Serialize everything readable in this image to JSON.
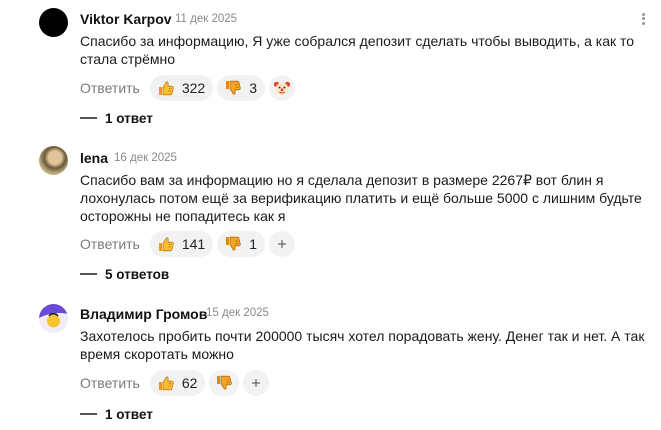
{
  "comments": [
    {
      "author": "Viktor Karpov",
      "date": "11 дек 2025",
      "text": "Спасибо за информацию, Я уже собрался депозит сделать чтобы выводить, а как то стала стрёмно",
      "reply_label": "Ответить",
      "likes": "322",
      "dislikes": "3",
      "extra_reaction": "clown-emoji-icon",
      "replies": "1 ответ"
    },
    {
      "author": "lena",
      "date": "16 дек 2025",
      "text": "Спасибо вам за информацию но я сделала депозит в размере 2267₽ вот блин я лохонулась потом ещё за верификацию платить и ещё больше 5000 с лишним будьте осторожны не попадитесь как я",
      "reply_label": "Ответить",
      "likes": "141",
      "dislikes": "1",
      "replies": "5 ответов"
    },
    {
      "author": "Владимир Громов",
      "date": "15 дек 2025",
      "text": "Захотелось пробить почти 200000 тысяч хотел порадовать жену. Денег так и нет. А так время скоротать можно",
      "reply_label": "Ответить",
      "likes": "62",
      "dislikes": "",
      "replies": "1 ответ"
    }
  ],
  "colors": {
    "thumb": "#f5b82e",
    "thumb_outline": "#c77a14",
    "dislike": "#f0a21f",
    "pill_bg": "#f2f2f2",
    "muted": "#7a7a7a"
  }
}
